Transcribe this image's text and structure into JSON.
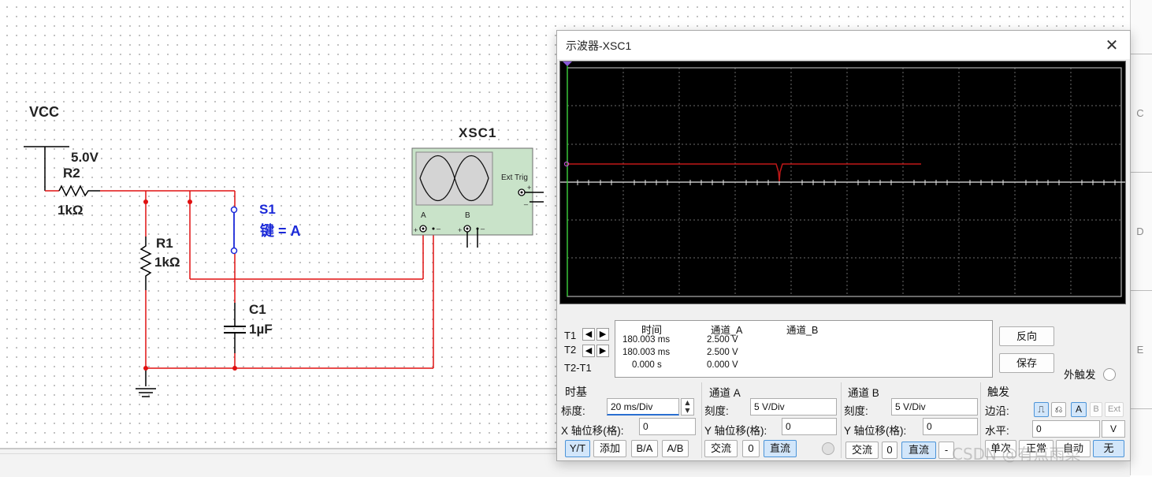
{
  "circuit": {
    "vcc_label": "VCC",
    "vcc_value": "5.0V",
    "r2_name": "R2",
    "r2_value": "1kΩ",
    "r1_name": "R1",
    "r1_value": "1kΩ",
    "s1_name": "S1",
    "s1_key": "键 = A",
    "c1_name": "C1",
    "c1_value": "1µF",
    "xsc_name": "XSC1",
    "ext_trig": "Ext Trig",
    "ch_a": "A",
    "ch_b": "B",
    "plus": "+",
    "minus": "_",
    "wire_color": "#e01010",
    "switch_color": "#1a28d8"
  },
  "sidebar": {
    "letters": [
      "C",
      "D",
      "E"
    ]
  },
  "scope": {
    "title": "示波器-XSC1",
    "close_icon": "close-icon",
    "trace_color": "#c01818",
    "readout": {
      "headers": [
        "时间",
        "通道_A",
        "通道_B"
      ],
      "rows": [
        {
          "label": "T1",
          "time": "180.003 ms",
          "a": "2.500 V",
          "b": ""
        },
        {
          "label": "T2",
          "time": "180.003 ms",
          "a": "2.500 V",
          "b": ""
        },
        {
          "label": "T2-T1",
          "time": "0.000 s",
          "a": "0.000 V",
          "b": ""
        }
      ]
    },
    "buttons": {
      "reverse": "反向",
      "save": "保存",
      "ext_trigger": "外触发"
    },
    "timebase": {
      "title": "时基",
      "scale_label": "标度:",
      "scale_value": "20 ms/Div",
      "xpos_label": "X 轴位移(格):",
      "xpos_value": "0",
      "modes": [
        "Y/T",
        "添加",
        "B/A",
        "A/B"
      ],
      "active_mode": "Y/T"
    },
    "channel_a": {
      "title": "通道 A",
      "scale_label": "刻度:",
      "scale_value": "5  V/Div",
      "ypos_label": "Y 轴位移(格):",
      "ypos_value": "0",
      "coupling": [
        "交流",
        "0",
        "直流"
      ],
      "active_coupling": "直流"
    },
    "channel_b": {
      "title": "通道 B",
      "scale_label": "刻度:",
      "scale_value": "5  V/Div",
      "ypos_label": "Y 轴位移(格):",
      "ypos_value": "0",
      "coupling": [
        "交流",
        "0",
        "直流",
        "-"
      ],
      "active_coupling": "直流"
    },
    "trigger": {
      "title": "触发",
      "edge_label": "边沿:",
      "edge_options": [
        "A",
        "B",
        "Ext"
      ],
      "level_label": "水平:",
      "level_value": "0",
      "level_unit": "V",
      "modes": [
        "单次",
        "正常",
        "自动",
        "无"
      ],
      "active_mode": "无"
    }
  },
  "watermark": "CSDN @有点雨菜"
}
